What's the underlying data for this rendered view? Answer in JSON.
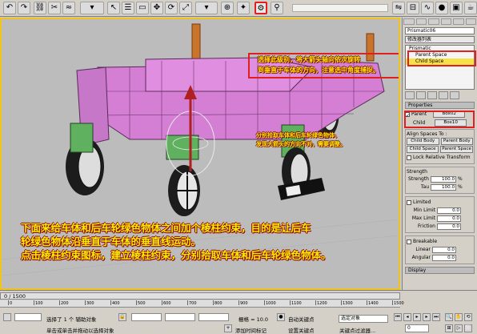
{
  "viewport": {
    "note_top_lines": [
      "选择此级别，将大箭头轴向依次旋转",
      "到垂直于车体的方向，注意选中角度捕捉。"
    ],
    "note_mid_lines": [
      "分别拾取车体和后车轮绿色物体，",
      "发现大箭头的方向不对，需要调整。"
    ],
    "main_lines": [
      "下面来给车体和后车轮绿色物体之间加个棱柱约束，目的是让后车",
      "轮绿色物体沿垂直于车体的垂直线运动。",
      "点击棱柱约束图标，建立棱柱约束，分别拾取车体和后车轮绿色物体。"
    ]
  },
  "panel": {
    "object_name": "Prismatic06",
    "modifier_list": "修改器列表",
    "stack": [
      "Prismatic",
      "Parent Space",
      "Child Space"
    ],
    "properties_title": "Properties",
    "parent_label": "Parent",
    "parent_value": "Box02",
    "child_label": "Child",
    "child_value": "Box10",
    "align_title": "Align Spaces To :",
    "child_body": "Child Body",
    "parent_body": "Parent Body",
    "child_space": "Child Space",
    "parent_space": "Parent Space",
    "lock_relative": "Lock Relative Transform",
    "strength_title": "Strength",
    "strength_label": "Strength",
    "strength_value": "100.0",
    "tau_label": "Tau",
    "tau_value": "100.0",
    "pct": "%",
    "limited": "Limited",
    "min_limit": "Min Limit",
    "max_limit": "Max Limit",
    "friction": "Friction",
    "zero": "0.0",
    "breakable": "Breakable",
    "linear": "Linear",
    "angular": "Angular",
    "display": "Display"
  },
  "bottom": {
    "time_label": "0 / 1500",
    "ruler": [
      "0",
      "100",
      "200",
      "300",
      "400",
      "500",
      "600",
      "700",
      "800",
      "900",
      "1000",
      "1100",
      "1200",
      "1300",
      "1400",
      "1500"
    ],
    "selected": "选择了 1 个 辅助对象",
    "hint": "单击或单击并拖动以选择对象",
    "grid_label": "栅格 = 10.0",
    "auto_key": "自动关键点",
    "selected_obj": "选定对象",
    "add_time_tag": "添加时间标记",
    "set_key": "设置关键点",
    "key_filter": "关键点过滤器...",
    "frame": "0"
  },
  "colors": {
    "accent": "#e02020",
    "note_text": "#ffee00",
    "viewport_border": "#f0c418",
    "car_body": "#d47fd4",
    "wheel_mount": "#5fb05f"
  }
}
